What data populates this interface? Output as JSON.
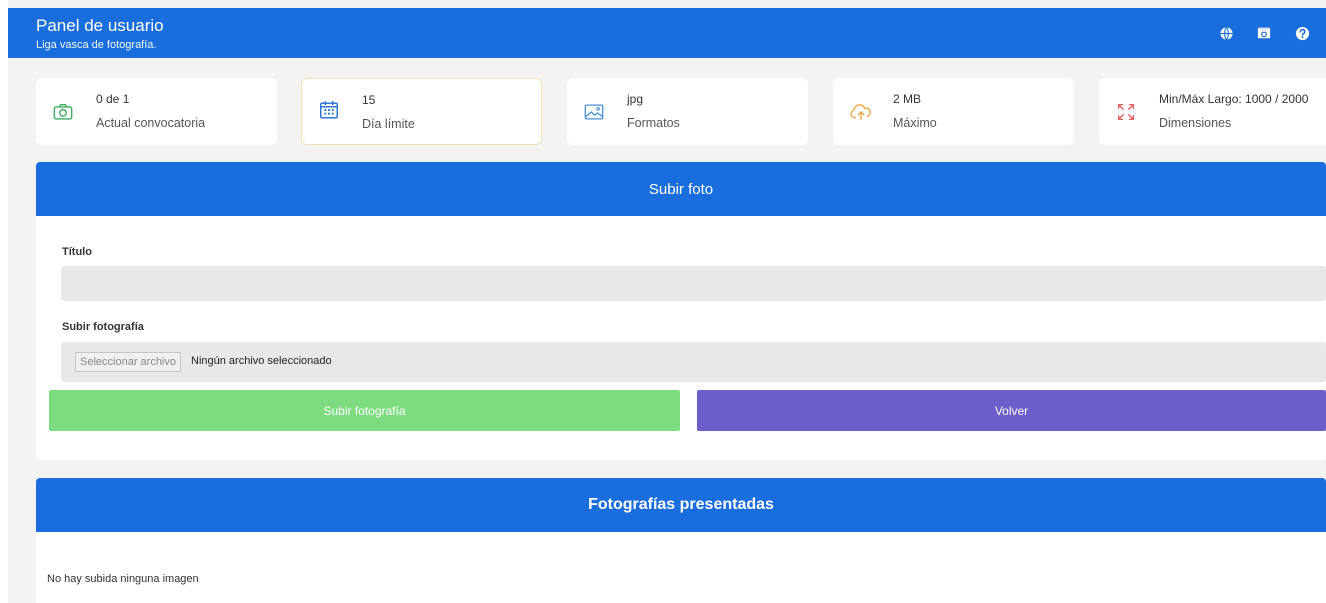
{
  "header": {
    "title": "Panel de usuario",
    "subtitle": "Liga vasca de fotografía.",
    "icons": [
      "globe-icon",
      "photo-frame-icon",
      "help-icon"
    ]
  },
  "stats": [
    {
      "value": "0 de 1",
      "label": "Actual convocatoria",
      "icon": "camera-icon",
      "color": "#3cae5f"
    },
    {
      "value": "15",
      "label": "Día límite",
      "icon": "calendar-icon",
      "color": "#1f6bd1"
    },
    {
      "value": "jpg",
      "label": "Formatos",
      "icon": "image-icon",
      "color": "#4a8fd6"
    },
    {
      "value": "2 MB",
      "label": "Máximo",
      "icon": "cloud-upload-icon",
      "color": "#f0a442"
    },
    {
      "value": "Min/Máx Largo: 1000 / 2000",
      "label": "Dimensiones",
      "icon": "expand-icon",
      "color": "#e2555a"
    }
  ],
  "upload": {
    "heading": "Subir foto",
    "title_label": "Título",
    "title_value": "",
    "file_label": "Subir fotografía",
    "file_button": "Seleccionar archivo",
    "file_status": "Ningún archivo seleccionado",
    "submit_label": "Subir fotografía",
    "back_label": "Volver"
  },
  "submitted": {
    "heading": "Fotografías presentadas",
    "empty_message": "No hay subida ninguna imagen"
  },
  "colors": {
    "brand": "#1a6ddd",
    "submit": "#7ddc7f",
    "back": "#6a5fcb",
    "highlight_border": "#f0e3b2"
  }
}
